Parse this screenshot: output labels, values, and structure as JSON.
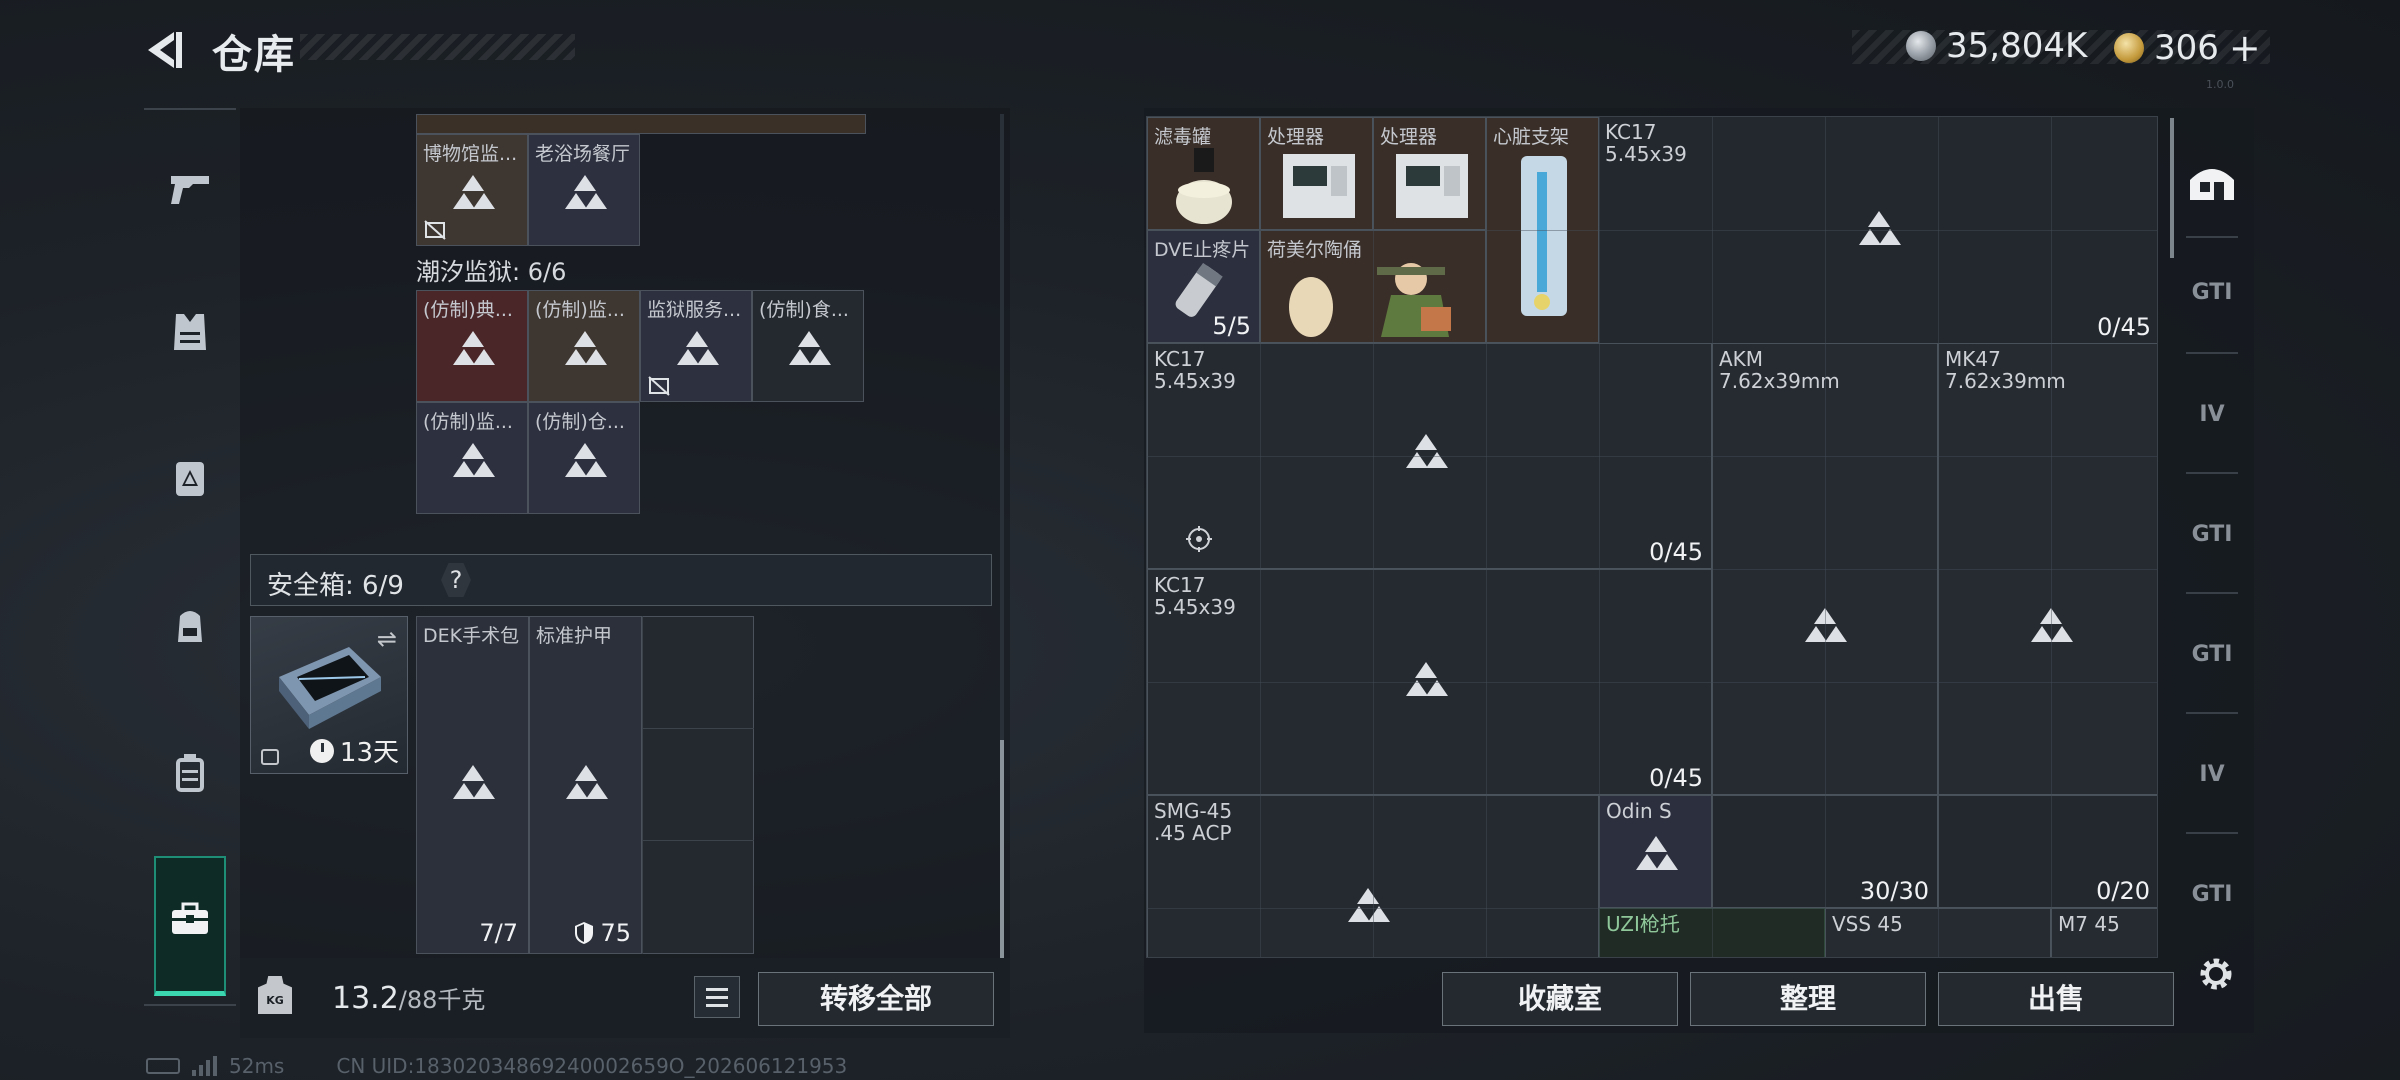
{
  "header": {
    "title": "仓库",
    "currency_silver": "35,804K",
    "currency_gold": "306",
    "add_label": "+",
    "version": "1.0.0"
  },
  "left_nav": {
    "items": [
      "weapon",
      "armor",
      "chest_rig",
      "backpack",
      "container",
      "safe_box"
    ],
    "active": "safe_box"
  },
  "container_area": {
    "row1": [
      {
        "name": "博物馆监...",
        "color": "brown",
        "no_insure": true
      },
      {
        "name": "老浴场餐厅",
        "color": "blue"
      }
    ],
    "prison_label": "潮汐监狱: 6/6",
    "row2": [
      {
        "name": "(仿制)典...",
        "color": "red"
      },
      {
        "name": "(仿制)监...",
        "color": "brown"
      },
      {
        "name": "监狱服务...",
        "color": "blue",
        "no_insure": true
      },
      {
        "name": "(仿制)食...",
        "color": "dark"
      }
    ],
    "row3": [
      {
        "name": "(仿制)监...",
        "color": "blue"
      },
      {
        "name": "(仿制)仓...",
        "color": "blue"
      }
    ]
  },
  "safe_box": {
    "label": "安全箱:",
    "count": "6/9",
    "help": "?",
    "days": "13天",
    "slots": [
      {
        "name": "DEK手术包",
        "count": "7/7"
      },
      {
        "name": "标准护甲",
        "count": "75"
      }
    ]
  },
  "bottom_left": {
    "weight": "13.2",
    "weight_max": "/88千克",
    "transfer_all": "转移全部"
  },
  "stash": {
    "items": [
      {
        "name": "滤毒罐"
      },
      {
        "name": "处理器"
      },
      {
        "name": "处理器"
      },
      {
        "name": "心脏支架"
      },
      {
        "name": "DVE止疼片",
        "count": "5/5"
      },
      {
        "name": "荷美尔陶俑"
      }
    ],
    "weapons": [
      {
        "name": "KC17\n5.45x39",
        "count": "0/45"
      },
      {
        "name": "KC17\n5.45x39",
        "count": "0/45"
      },
      {
        "name": "AKM\n7.62x39mm",
        "count": ""
      },
      {
        "name": "MK47\n7.62x39mm",
        "count": ""
      },
      {
        "name": "KC17\n5.45x39",
        "count": "0/45"
      },
      {
        "name": "SMG-45\n.45 ACP",
        "count": "30/30"
      },
      {
        "name": "Odin S",
        "count": ""
      },
      {
        "name": "",
        "count": "0/20"
      },
      {
        "name": "UZI枪托",
        "count": ""
      },
      {
        "name": "VSS 45",
        "count": ""
      },
      {
        "name": "M7 45",
        "count": ""
      }
    ]
  },
  "bottom_right": {
    "collection": "收藏室",
    "sort": "整理",
    "sell": "出售"
  },
  "right_tabs": [
    "GTI",
    "IV",
    "GTI",
    "GTI",
    "IV",
    "GTI"
  ],
  "status": {
    "ping": "52ms",
    "uid": "CN UID:18302034869240002659O_202606121953"
  }
}
